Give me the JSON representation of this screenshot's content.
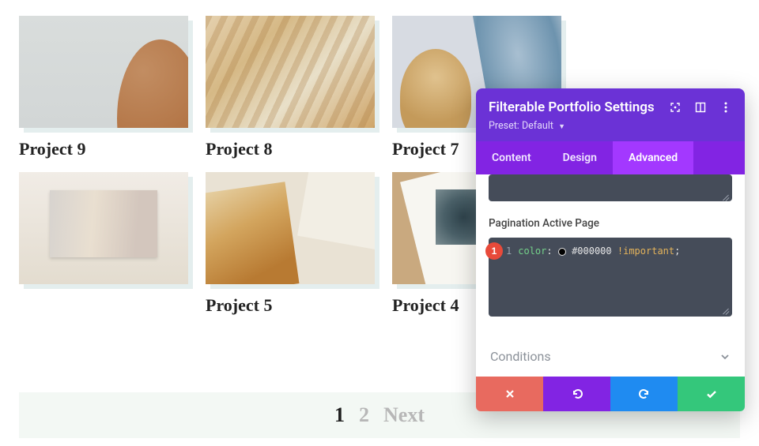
{
  "portfolio": {
    "items": [
      {
        "title": "Project 9"
      },
      {
        "title": "Project 8"
      },
      {
        "title": "Project 7"
      },
      {
        "title": "Project 5"
      },
      {
        "title": "Project 4"
      }
    ]
  },
  "pagination": {
    "active": "1",
    "page2": "2",
    "next": "Next"
  },
  "panel": {
    "title": "Filterable Portfolio Settings",
    "preset_label": "Preset:",
    "preset_value": "Default",
    "tabs": {
      "content": "Content",
      "design": "Design",
      "advanced": "Advanced"
    },
    "field_label": "Pagination Active Page",
    "step_badge": "1",
    "code": {
      "lineno": "1",
      "property": "color",
      "colon": ":",
      "value_hex": "#000000",
      "important": "!important",
      "semicolon": ";"
    },
    "accordion_label": "Conditions"
  }
}
